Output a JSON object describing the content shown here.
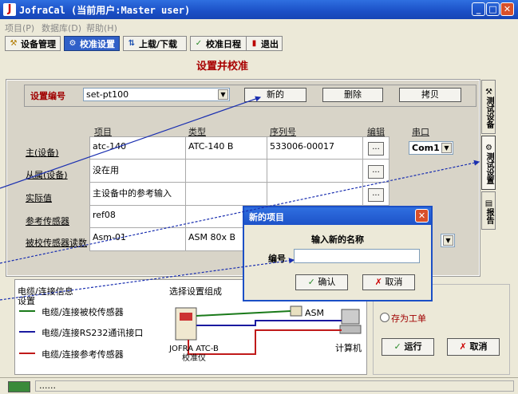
{
  "window": {
    "title": "JofraCal (当前用户:Master user)"
  },
  "menu": [
    "项目(P)",
    "数据库(D)",
    "帮助(H)"
  ],
  "toolbar": [
    {
      "label": "设备管理",
      "icon": "wrench-icon",
      "active": false
    },
    {
      "label": "校准设置",
      "icon": "gear-icon",
      "active": true
    },
    {
      "label": "上载/下载",
      "icon": "transfer-icon",
      "active": false
    },
    {
      "label": "校准日程",
      "icon": "check-icon",
      "active": false
    },
    {
      "label": "退出",
      "icon": "exit-icon",
      "active": false
    }
  ],
  "heading": "设置并校准",
  "setup": {
    "label": "设置编号",
    "value": "set-pt100",
    "buttons": {
      "new": "新的",
      "delete": "删除",
      "copy": "拷贝"
    }
  },
  "columns": {
    "item": "项目",
    "type": "类型",
    "serial": "序列号",
    "edit": "编辑",
    "port": "串口"
  },
  "rows": [
    {
      "label": "主(设备)",
      "item": "atc-140",
      "type": "ATC-140 B",
      "serial": "533006-00017",
      "port": "Com1"
    },
    {
      "label": "从属(设备)",
      "item": "没在用",
      "type": "",
      "serial": "",
      "port": ""
    },
    {
      "label": "实际值",
      "item": "主设备中的参考输入",
      "type": "",
      "serial": "",
      "port": ""
    },
    {
      "label": "参考传感器",
      "item": "ref08",
      "type": "",
      "serial": "",
      "port": ""
    },
    {
      "label": "被校传感器读数",
      "item": "Asm-01",
      "type": "ASM 80x B",
      "serial": "",
      "port": ""
    }
  ],
  "vtabs": [
    "测试设备",
    "测试设置",
    "报告"
  ],
  "legend": {
    "title": "电缆/连接信息",
    "subtitle": "设置",
    "items": [
      {
        "label": "电缆/连接被校传感器",
        "color": "#1a7a1a"
      },
      {
        "label": "电缆/连接RS232通讯接口",
        "color": "#1a1aa0"
      },
      {
        "label": "电缆/连接参考传感器",
        "color": "#c01a1a"
      }
    ],
    "diagram_title": "选择设置组成",
    "device_label": "JOFRA ATC-B\n校准仪",
    "asm_label": "ASM",
    "computer_label": "计算机"
  },
  "right_group": {
    "radio_label": "存为工单",
    "run": "运行",
    "cancel": "取消"
  },
  "dialog": {
    "title": "新的项目",
    "prompt": "输入新的名称",
    "field_label": "编号",
    "field_value": "",
    "ok": "确认",
    "cancel": "取消"
  },
  "status": {
    "text": "......"
  }
}
